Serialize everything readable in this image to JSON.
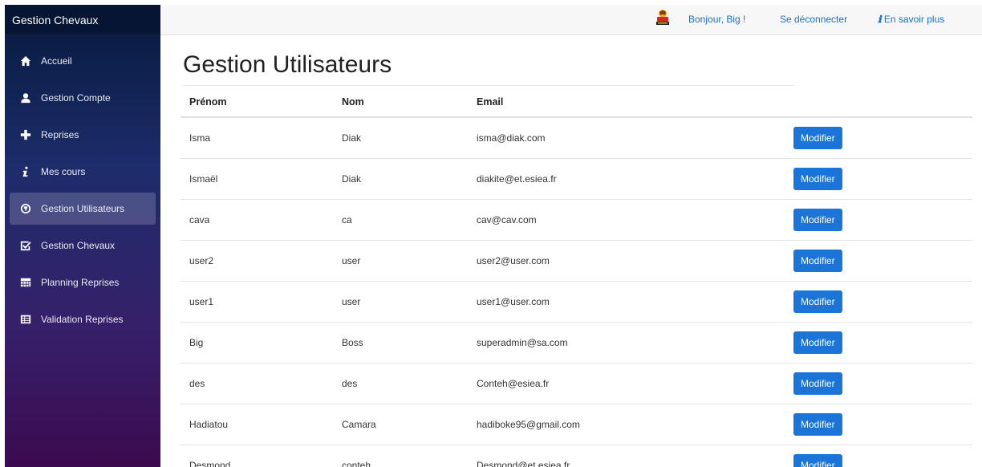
{
  "app": {
    "brand": "Gestion Chevaux"
  },
  "sidebar": {
    "items": [
      {
        "label": "Accueil",
        "icon": "home-icon"
      },
      {
        "label": "Gestion Compte",
        "icon": "user-icon"
      },
      {
        "label": "Reprises",
        "icon": "plus-icon"
      },
      {
        "label": "Mes cours",
        "icon": "info-icon"
      },
      {
        "label": "Gestion Utilisateurs",
        "icon": "compass-icon",
        "active": true
      },
      {
        "label": "Gestion Chevaux",
        "icon": "checkbox-icon"
      },
      {
        "label": "Planning Reprises",
        "icon": "calendar-icon"
      },
      {
        "label": "Validation Reprises",
        "icon": "table-icon"
      }
    ]
  },
  "topbar": {
    "greeting": "Bonjour, Big !",
    "logout": "Se déconnecter",
    "about": "En savoir plus"
  },
  "main": {
    "title": "Gestion Utilisateurs",
    "columns": [
      "Prénom",
      "Nom",
      "Email"
    ],
    "button_label": "Modifier",
    "rows": [
      {
        "prenom": "Isma",
        "nom": "Diak",
        "email": "isma@diak.com"
      },
      {
        "prenom": "Ismaël",
        "nom": "Diak",
        "email": "diakite@et.esiea.fr"
      },
      {
        "prenom": "cava",
        "nom": "ca",
        "email": "cav@cav.com"
      },
      {
        "prenom": "user2",
        "nom": "user",
        "email": "user2@user.com"
      },
      {
        "prenom": "user1",
        "nom": "user",
        "email": "user1@user.com"
      },
      {
        "prenom": "Big",
        "nom": "Boss",
        "email": "superadmin@sa.com"
      },
      {
        "prenom": "des",
        "nom": "des",
        "email": "Conteh@esiea.fr"
      },
      {
        "prenom": "Hadiatou",
        "nom": "Camara",
        "email": "hadiboke95@gmail.com"
      },
      {
        "prenom": "Desmond",
        "nom": "conteh",
        "email": "Desmond@et.esiea.fr"
      }
    ]
  },
  "colors": {
    "accent": "#1b74d8",
    "link": "#1a6fc9",
    "sidebar_top": "#061a3c",
    "sidebar_bottom": "#3c0a4f"
  }
}
